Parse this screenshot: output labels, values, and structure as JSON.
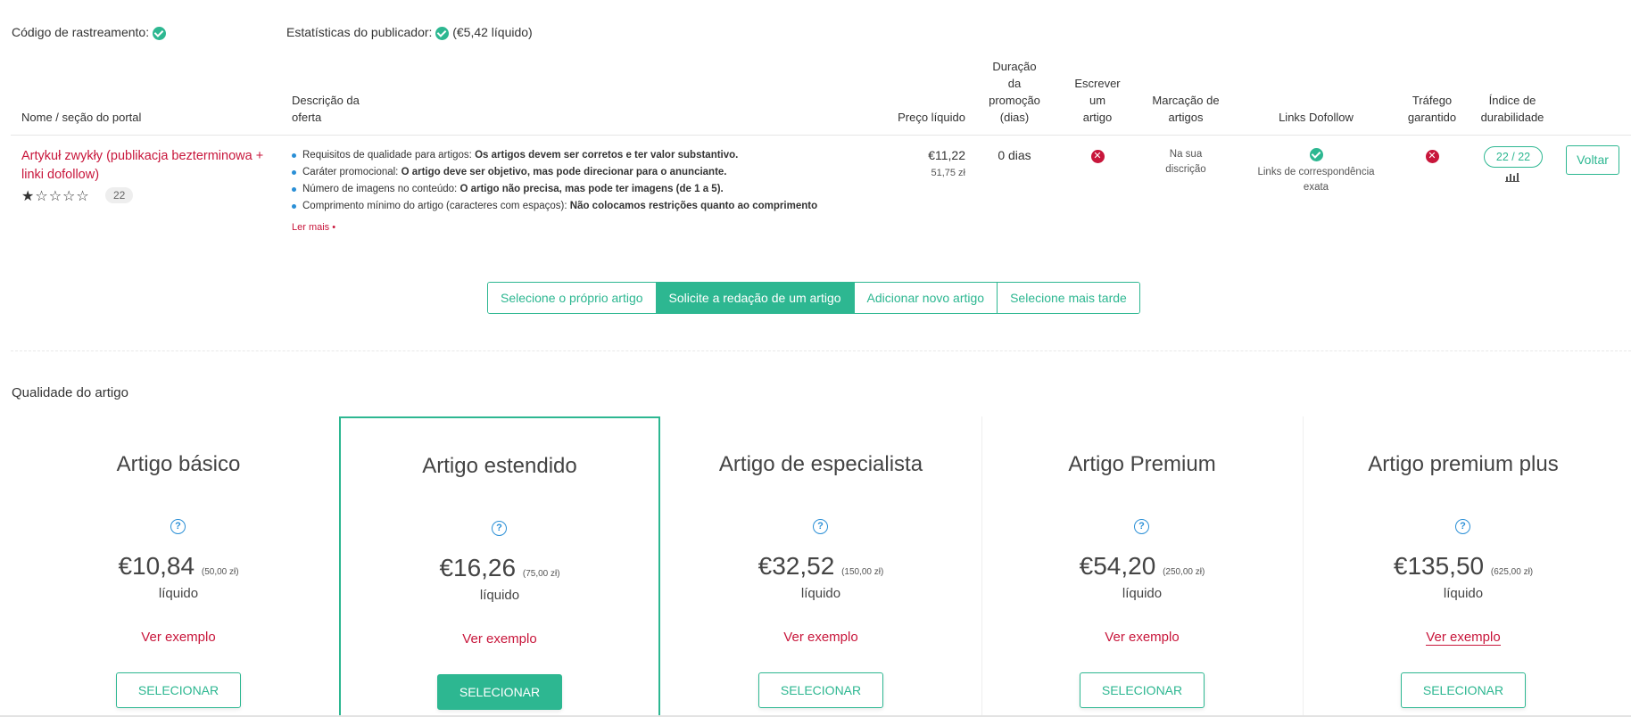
{
  "top": {
    "tracking_label": "Código de rastreamento:",
    "publisher_label": "Estatísticas do publicador:",
    "publisher_value": "(€5,42 líquido)"
  },
  "table": {
    "headers": {
      "name": "Nome / seção do portal",
      "desc": "Descrição da\noferta",
      "price": "Preço líquido",
      "duration": "Duração\nda\npromoção\n(dias)",
      "write": "Escrever\num\nartigo",
      "markup": "Marcação de\nartigos",
      "dofollow": "Links Dofollow",
      "traffic": "Tráfego\ngarantido",
      "durability": "Índice de\ndurabilidade"
    },
    "row": {
      "portal_name": "Artykuł zwykły (publikacja bezterminowa + linki dofollow)",
      "stars": "★☆☆☆☆",
      "reviews": "22",
      "requirements": [
        {
          "label": "Requisitos de qualidade para artigos:",
          "value": "Os artigos devem ser corretos e ter valor substantivo."
        },
        {
          "label": "Caráter promocional:",
          "value": "O artigo deve ser objetivo, mas pode direcionar para o anunciante."
        },
        {
          "label": "Número de imagens no conteúdo:",
          "value": "O artigo não precisa, mas pode ter imagens (de 1 a 5)."
        },
        {
          "label": "Comprimento mínimo do artigo (caracteres com espaços):",
          "value": "Não colocamos restrições quanto ao comprimento"
        }
      ],
      "read_more": "Ler mais •",
      "price": "€11,22",
      "price_pln": "51,75 zł",
      "duration": "0 dias",
      "markup": "Na sua\ndiscrição",
      "dofollow_text": "Links de correspondência\nexata",
      "durability": "22 / 22",
      "back": "Voltar"
    }
  },
  "options": [
    {
      "label": "Selecione o próprio artigo",
      "active": false
    },
    {
      "label": "Solicite a redação de um artigo",
      "active": true
    },
    {
      "label": "Adicionar novo artigo",
      "active": false
    },
    {
      "label": "Selecione mais tarde",
      "active": false
    }
  ],
  "quality": {
    "title": "Qualidade do artigo",
    "cards": [
      {
        "title": "Artigo básico",
        "price": "€10,84",
        "pln": "(50,00 zł)",
        "net": "líquido",
        "example": "Ver exemplo",
        "button": "SELECIONAR",
        "selected": false
      },
      {
        "title": "Artigo estendido",
        "price": "€16,26",
        "pln": "(75,00 zł)",
        "net": "líquido",
        "example": "Ver exemplo",
        "button": "SELECIONAR",
        "selected": true
      },
      {
        "title": "Artigo de especialista",
        "price": "€32,52",
        "pln": "(150,00 zł)",
        "net": "líquido",
        "example": "Ver exemplo",
        "button": "SELECIONAR",
        "selected": false
      },
      {
        "title": "Artigo Premium",
        "price": "€54,20",
        "pln": "(250,00 zł)",
        "net": "líquido",
        "example": "Ver exemplo",
        "button": "SELECIONAR",
        "selected": false
      },
      {
        "title": "Artigo premium plus",
        "price": "€135,50",
        "pln": "(625,00 zł)",
        "net": "líquido",
        "example": "Ver exemplo",
        "button": "SELECIONAR",
        "selected": false
      }
    ]
  },
  "colors": {
    "accent": "#2db791",
    "link": "#c8163b",
    "info": "#2a8fd6"
  }
}
